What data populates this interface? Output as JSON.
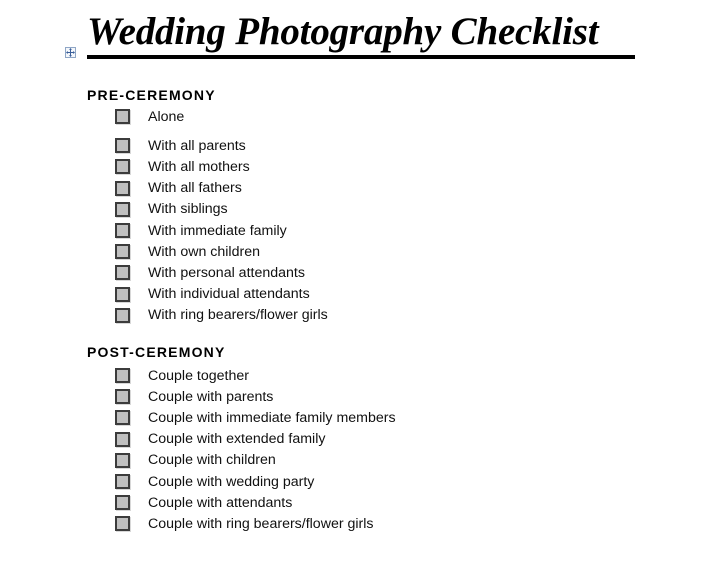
{
  "document": {
    "title": "Wedding Photography Checklist",
    "table_move_handle_icon": "move-arrows-icon"
  },
  "sections": [
    {
      "heading": "PRE-CEREMONY",
      "items": [
        {
          "label": "Alone",
          "checked": false
        },
        {
          "label": "With all parents",
          "checked": false
        },
        {
          "label": "With all mothers",
          "checked": false
        },
        {
          "label": "With all fathers",
          "checked": false
        },
        {
          "label": "With siblings",
          "checked": false
        },
        {
          "label": "With immediate family",
          "checked": false
        },
        {
          "label": "With own children",
          "checked": false
        },
        {
          "label": "With personal attendants",
          "checked": false
        },
        {
          "label": "With individual attendants",
          "checked": false
        },
        {
          "label": "With ring bearers/flower girls",
          "checked": false
        }
      ]
    },
    {
      "heading": "POST-CEREMONY",
      "items": [
        {
          "label": "Couple together",
          "checked": false
        },
        {
          "label": "Couple with parents",
          "checked": false
        },
        {
          "label": "Couple with immediate family members",
          "checked": false
        },
        {
          "label": "Couple with extended family",
          "checked": false
        },
        {
          "label": "Couple with children",
          "checked": false
        },
        {
          "label": "Couple with wedding party",
          "checked": false
        },
        {
          "label": "Couple with attendants",
          "checked": false
        },
        {
          "label": "Couple with ring bearers/flower girls",
          "checked": false
        }
      ]
    }
  ]
}
